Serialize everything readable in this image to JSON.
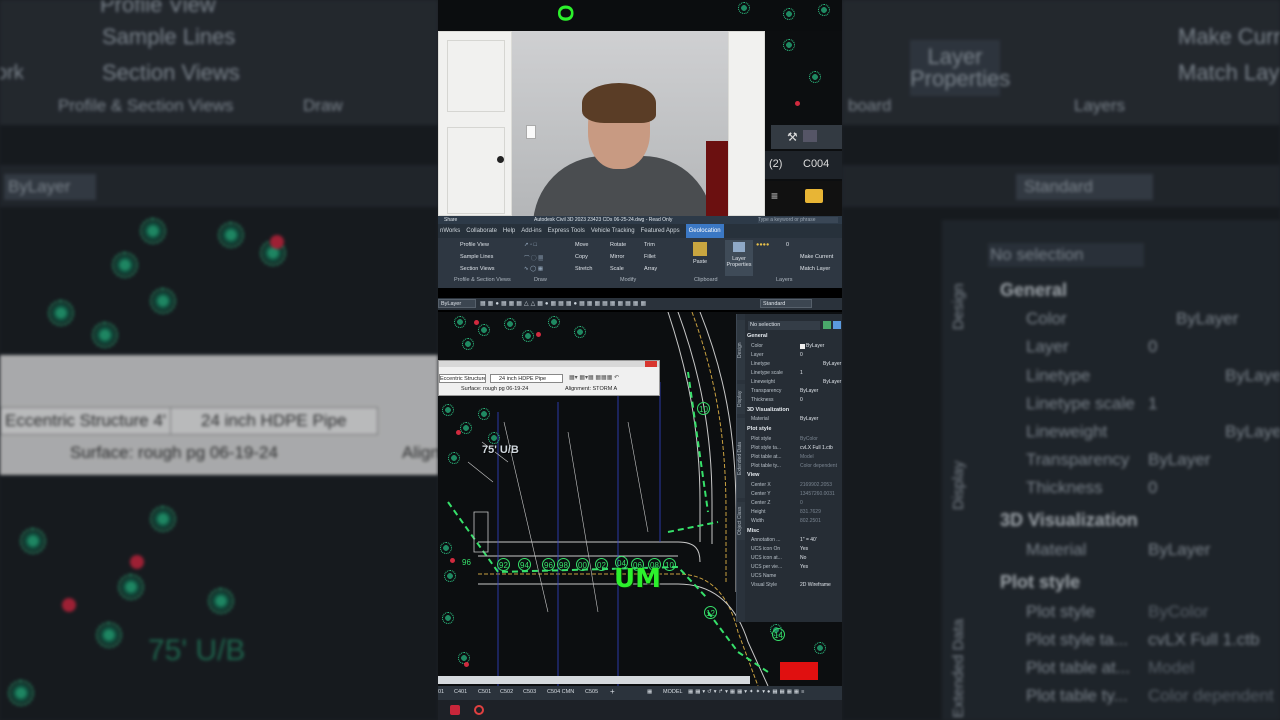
{
  "app": {
    "title": "Autodesk Civil 3D 2023   23423 CDs 06-25-24.dwg - Read Only",
    "share_label": "Share",
    "search_placeholder": "Type a keyword or phrase",
    "ribbon_tabs": [
      "nWorks",
      "Collaborate",
      "Help",
      "Add-ins",
      "Express Tools",
      "Vehicle Tracking",
      "Featured Apps",
      "Geolocation"
    ],
    "active_tab": "Geolocation"
  },
  "ribbon": {
    "profile_view": "Profile View",
    "sample_lines": "Sample Lines",
    "section_views": "Section Views",
    "move": "Move",
    "rotate": "Rotate",
    "trim": "Trim",
    "copy": "Copy",
    "mirror": "Mirror",
    "fillet": "Fillet",
    "stretch": "Stretch",
    "scale": "Scale",
    "array": "Array",
    "paste": "Paste",
    "layer_properties": "Layer Properties",
    "make_current": "Make Current",
    "match_layer": "Match Layer",
    "layer_value": "0",
    "panels": [
      "Profile & Section Views",
      "Draw",
      "Modify",
      "Clipboard",
      "Layers"
    ]
  },
  "toolbar": {
    "layer_combo": "ByLayer",
    "style_combo": "Standard"
  },
  "pipe_toolbar": {
    "structure": "Eccentric Structure 4'",
    "pipe": "24 inch HDPE Pipe",
    "surface": "Surface: rough pg 06-19-24",
    "alignment": "Alignment: STORM A"
  },
  "drawing": {
    "tree_label": "75' U/B",
    "overlay_caption": "UM",
    "numbers": [
      "10",
      "92",
      "94",
      "96",
      "98",
      "00",
      "02",
      "04",
      "06",
      "08",
      "10",
      "12",
      "14",
      "96"
    ]
  },
  "properties": {
    "selection": "No selection",
    "side_tabs": [
      "Design",
      "Display",
      "Extended Data",
      "Object Class"
    ],
    "general_title": "General",
    "general": [
      {
        "k": "Color",
        "v": "ByLayer"
      },
      {
        "k": "Layer",
        "v": "0"
      },
      {
        "k": "Linetype",
        "v": "ByLayer"
      },
      {
        "k": "Linetype scale",
        "v": "1"
      },
      {
        "k": "Lineweight",
        "v": "ByLayer"
      },
      {
        "k": "Transparency",
        "v": "ByLayer"
      },
      {
        "k": "Thickness",
        "v": "0"
      }
    ],
    "viz_title": "3D Visualization",
    "viz": [
      {
        "k": "Material",
        "v": "ByLayer"
      }
    ],
    "plot_title": "Plot style",
    "plot": [
      {
        "k": "Plot style",
        "v": "ByColor"
      },
      {
        "k": "Plot style ta...",
        "v": "cvLX Full 1.ctb"
      },
      {
        "k": "Plot table at...",
        "v": "Model"
      },
      {
        "k": "Plot table ty...",
        "v": "Color dependent"
      }
    ],
    "view_title": "View",
    "view": [
      {
        "k": "Center X",
        "v": "2169902.2053"
      },
      {
        "k": "Center Y",
        "v": "13457260.0031"
      },
      {
        "k": "Center Z",
        "v": "0"
      },
      {
        "k": "Height",
        "v": "831.7629"
      },
      {
        "k": "Width",
        "v": "802.2501"
      }
    ],
    "misc_title": "Misc",
    "misc": [
      {
        "k": "Annotation ...",
        "v": "1\" = 40'"
      },
      {
        "k": "UCS icon On",
        "v": "Yes"
      },
      {
        "k": "UCS icon at...",
        "v": "No"
      },
      {
        "k": "UCS per vie...",
        "v": "Yes"
      },
      {
        "k": "UCS Name",
        "v": ""
      },
      {
        "k": "Visual Style",
        "v": "2D Wireframe"
      }
    ]
  },
  "status": {
    "layout_tabs": [
      "01",
      "C401",
      "C501",
      "C502",
      "C503",
      "C504 CMN",
      "C505"
    ],
    "model_label": "MODEL"
  },
  "topstrip": {
    "count_label": "(2)",
    "sheet_label": "C004"
  },
  "background": {
    "left_items": [
      "Profile View",
      "Sample Lines",
      "Section Views",
      "Profile & Section Views",
      "Draw",
      "ByLayer",
      "Eccentric Structure 4'",
      "24 inch HDPE Pipe",
      "Surface: rough pg 06-19-24",
      "Align",
      "75' U/B",
      "ork"
    ],
    "right_items": [
      "Layer Properties",
      "Make Curren",
      "Match Layer",
      "Layers",
      "Standard",
      "No selection",
      "General",
      "Color",
      "ByLayer",
      "Layer",
      "0",
      "Linetype",
      "ByLayer",
      "Linetype scale",
      "1",
      "Lineweight",
      "ByLayer",
      "Transparency",
      "ByLayer",
      "Thickness",
      "0",
      "3D Visualization",
      "Material",
      "ByLayer",
      "Plot style",
      "Plot style",
      "ByColor",
      "Plot style ta...",
      "cvLX Full 1.ctb",
      "Plot table at...",
      "Model",
      "Plot table ty...",
      "Color dependent",
      "Design",
      "Display",
      "Extended Data",
      "board"
    ]
  },
  "colors": {
    "accent": "#3b78c4",
    "green_overlay": "#2cf02c",
    "tree_green": "#2fd48f",
    "tree_red": "#c9213a",
    "red_block": "#e01010"
  }
}
